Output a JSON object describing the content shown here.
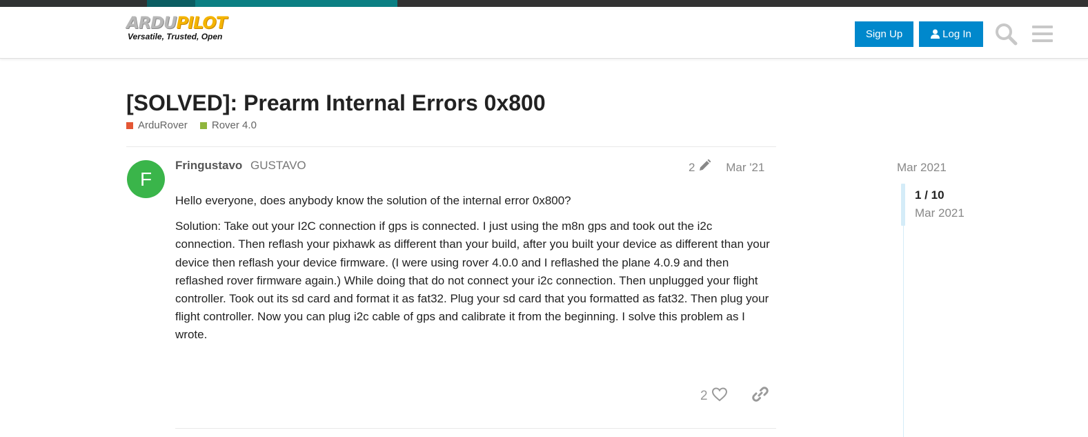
{
  "colors": {
    "accent": "#0088cc",
    "avatar_bg": "#3ab54a",
    "category_ardurover": "#e45735",
    "category_rover40": "#8fb53d"
  },
  "header": {
    "logo_part1": "ARDU",
    "logo_part2": "PILOT",
    "logo_tagline": "Versatile, Trusted, Open",
    "signup_label": "Sign Up",
    "login_label": "Log In",
    "icons": [
      "user-icon",
      "search-icon",
      "menu-icon"
    ]
  },
  "topic": {
    "title": "[SOLVED]: Prearm Internal Errors 0x800",
    "categories": [
      {
        "name": "ArduRover",
        "color": "#e45735"
      },
      {
        "name": "Rover 4.0",
        "color": "#8fb53d"
      }
    ]
  },
  "post": {
    "avatar_letter": "F",
    "username": "Fringustavo",
    "full_name": "GUSTAVO",
    "edit_count": "2",
    "date": "Mar '21",
    "paragraphs": [
      "Hello everyone, does anybody know the solution of the internal error 0x800?",
      "Solution: Take out your I2C connection if gps is connected. I just using the m8n gps and took out the i2c connection. Then reflash your pixhawk as different than your build, after you built your device as different than your device then reflash your device firmware. (I were using rover 4.0.0 and I reflashed the plane 4.0.9 and then reflashed rover firmware again.) While doing that do not connect your i2c connection. Then unplugged your flight controller. Took out its sd card and format it as fat32. Plug your sd card that you formatted as fat32. Then plug your flight controller. Now you can plug i2c cable of gps and calibrate it from the beginning. I solve this problem as I wrote."
    ],
    "like_count": "2"
  },
  "timeline": {
    "start_date": "Mar 2021",
    "position": "1 / 10",
    "current_date": "Mar 2021"
  }
}
